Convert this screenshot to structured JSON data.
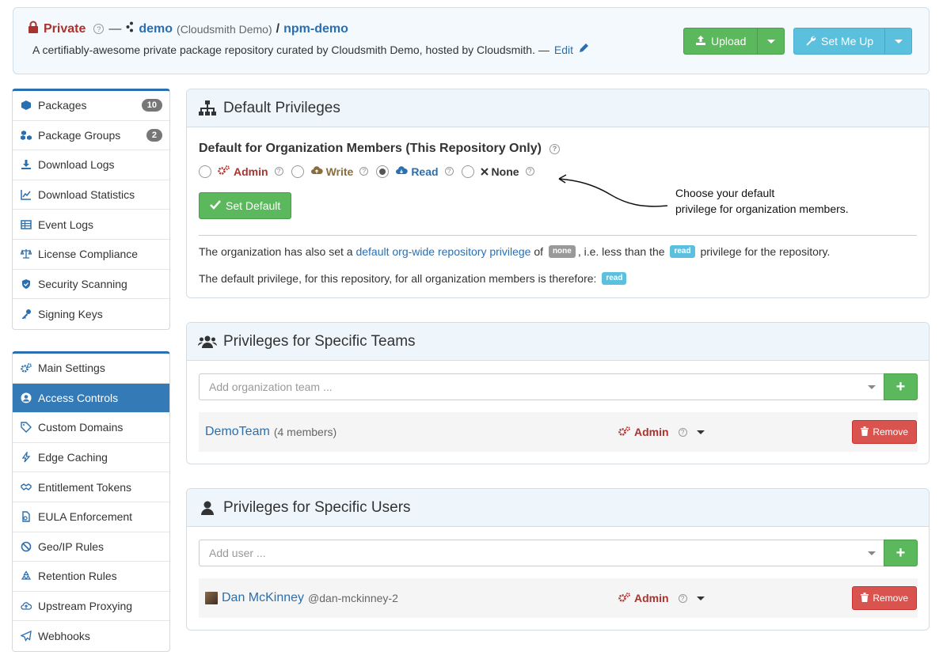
{
  "header": {
    "visibility": "Private",
    "dash": "—",
    "org_name": "demo",
    "org_desc": "(Cloudsmith Demo)",
    "slash": "/",
    "repo_name": "npm-demo",
    "description": "A certifiably-awesome private package repository curated by Cloudsmith Demo, hosted by Cloudsmith. —",
    "edit_label": "Edit",
    "upload_label": "Upload",
    "setmeup_label": "Set Me Up"
  },
  "sidebar": {
    "group1": [
      {
        "label": "Packages",
        "icon": "cube-icon",
        "badge": "10"
      },
      {
        "label": "Package Groups",
        "icon": "cubes-icon",
        "badge": "2"
      },
      {
        "label": "Download Logs",
        "icon": "download-icon"
      },
      {
        "label": "Download Statistics",
        "icon": "chart-icon"
      },
      {
        "label": "Event Logs",
        "icon": "table-icon"
      },
      {
        "label": "License Compliance",
        "icon": "balance-icon"
      },
      {
        "label": "Security Scanning",
        "icon": "shield-icon"
      },
      {
        "label": "Signing Keys",
        "icon": "key-icon"
      }
    ],
    "group2": [
      {
        "label": "Main Settings",
        "icon": "cogs-icon"
      },
      {
        "label": "Access Controls",
        "icon": "user-circle-icon",
        "active": true
      },
      {
        "label": "Custom Domains",
        "icon": "tag-icon"
      },
      {
        "label": "Edge Caching",
        "icon": "bolt-icon"
      },
      {
        "label": "Entitlement Tokens",
        "icon": "handshake-icon"
      },
      {
        "label": "EULA Enforcement",
        "icon": "document-icon"
      },
      {
        "label": "Geo/IP Rules",
        "icon": "ban-icon"
      },
      {
        "label": "Retention Rules",
        "icon": "recycle-icon"
      },
      {
        "label": "Upstream Proxying",
        "icon": "cloud-upload-icon"
      },
      {
        "label": "Webhooks",
        "icon": "paper-plane-icon"
      }
    ]
  },
  "default_privileges": {
    "title": "Default Privileges",
    "subtitle": "Default for Organization Members (This Repository Only)",
    "options": {
      "admin": "Admin",
      "write": "Write",
      "read": "Read",
      "none": "None"
    },
    "selected": "read",
    "set_default_label": "Set Default",
    "annotation_line1": "Choose your default",
    "annotation_line2": "privilege for organization members.",
    "info1_pre": "The organization has also set a",
    "info1_link": "default org-wide repository privilege",
    "info1_of": "of",
    "info1_label_none": "none",
    "info1_mid": ", i.e. less than the",
    "info1_label_read": "read",
    "info1_post": "privilege for the repository.",
    "info2_text": "The default privilege, for this repository, for all organization members is therefore:",
    "info2_label": "read"
  },
  "teams": {
    "title": "Privileges for Specific Teams",
    "placeholder": "Add organization team ...",
    "add_label": "+",
    "entries": [
      {
        "name": "DemoTeam",
        "meta": "(4 members)",
        "privilege": "Admin",
        "remove_label": "Remove"
      }
    ]
  },
  "users": {
    "title": "Privileges for Specific Users",
    "placeholder": "Add user ...",
    "add_label": "+",
    "entries": [
      {
        "name": "Dan McKinney",
        "meta": "@dan-mckinney-2",
        "privilege": "Admin",
        "remove_label": "Remove"
      }
    ]
  },
  "colors": {
    "primary": "#2a6fb0",
    "success": "#5cb85c",
    "info": "#5bc0de",
    "danger": "#d9534f",
    "admin": "#a9332f"
  }
}
